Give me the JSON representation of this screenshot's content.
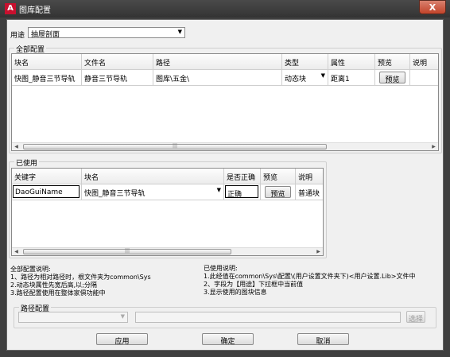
{
  "window": {
    "title": "图库配置",
    "close_glyph": "X"
  },
  "usage": {
    "label": "用途",
    "value": "抽屉剖面"
  },
  "all_config": {
    "group_label": "全部配置",
    "columns": [
      "块名",
      "文件名",
      "路径",
      "类型",
      "属性",
      "预览",
      "说明"
    ],
    "rows": [
      {
        "block": "快图_静音三节导轨",
        "file": "静音三节导轨",
        "path": "图库\\五金\\",
        "type": "动态块",
        "attr": "距离1",
        "preview": "预览",
        "note": ""
      }
    ]
  },
  "used": {
    "group_label": "已使用",
    "columns": [
      "关键字",
      "块名",
      "是否正确",
      "预览",
      "说明"
    ],
    "rows": [
      {
        "keyword": "DaoGuiName",
        "block": "快图_静音三节导轨",
        "correct": "正确",
        "preview": "预览",
        "note": "普通块"
      }
    ]
  },
  "all_desc": {
    "title": "全部配置说明:",
    "lines": [
      "1、路径为相对路径时，根文件夹为common\\Sys",
      "2.动态块属性先宽后高,以;分隔",
      "3.路径配置使用在整体家俱功能中"
    ]
  },
  "used_desc": {
    "title": "已使用说明:",
    "lines": [
      "1.此经值在common\\Sys\\配置\\(用户设置文件夹下)<用户设置.Lib>文件中",
      "2、字段为【用途】下拉框中当前值",
      "3.显示使用的图块信息"
    ]
  },
  "path_config": {
    "label": "路径配置",
    "select_value": "",
    "path_value": "",
    "choose_label": "选择"
  },
  "buttons": {
    "apply": "应用",
    "ok": "确定",
    "cancel": "取消"
  },
  "icons": {
    "app": "autocad-logo-icon",
    "dropdown": "chevron-down-icon"
  }
}
